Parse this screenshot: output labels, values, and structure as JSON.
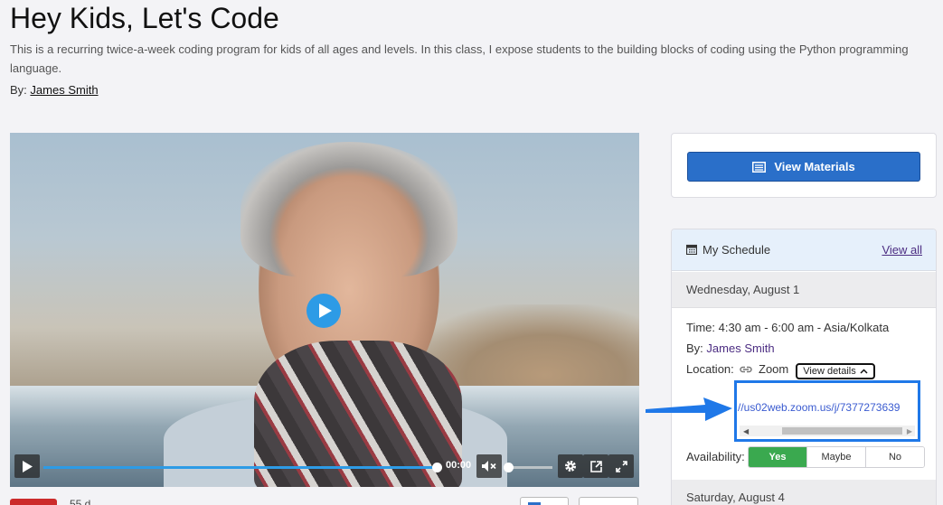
{
  "page": {
    "title": "Hey Kids, Let's Code",
    "description": "This is a recurring twice-a-week coding program for kids of all ages and levels. In this class, I expose students to the building blocks of coding using the Python programming language.",
    "by_label": "By:",
    "author": "James Smith"
  },
  "video": {
    "time": "00:00",
    "progress_percent": 100,
    "volume_percent": 0,
    "accent": "#2d9be6"
  },
  "materials": {
    "button_label": "View Materials"
  },
  "schedule": {
    "title": "My Schedule",
    "view_all": "View all",
    "days": [
      {
        "date": "Wednesday, August 1",
        "time_label": "Time:",
        "time_value": "4:30 am - 6:00 am - Asia/Kolkata",
        "by_label": "By:",
        "by_value": "James Smith",
        "location_label": "Location:",
        "location_value": "Zoom",
        "details_button": "View details",
        "url": "//us02web.zoom.us/j/7377273639",
        "availability_label": "Availability:",
        "availability_options": [
          "Yes",
          "Maybe",
          "No"
        ],
        "availability_selected": "Yes"
      },
      {
        "date": "Saturday, August 4"
      }
    ]
  },
  "bottom": {
    "fragment_text": "55 d"
  },
  "colors": {
    "primary_button": "#2a6fc9",
    "link_purple": "#4c2d82",
    "highlight_border": "#1f78e8",
    "yes_green": "#3aa94f"
  }
}
